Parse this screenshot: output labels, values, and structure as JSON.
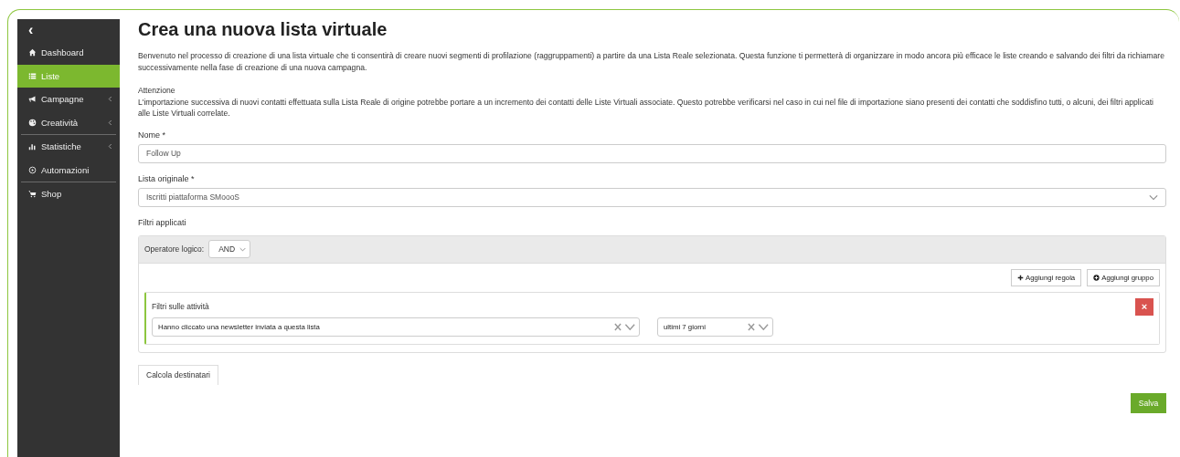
{
  "sidebar": {
    "collapse": "‹",
    "groups": [
      {
        "items": [
          {
            "label": "Dashboard",
            "selected": false,
            "submenu": false
          },
          {
            "label": "Liste",
            "selected": true,
            "submenu": false
          },
          {
            "label": "Campagne",
            "selected": false,
            "submenu": true
          },
          {
            "label": "Creatività",
            "selected": false,
            "submenu": true
          }
        ]
      },
      {
        "items": [
          {
            "label": "Statistiche",
            "selected": false,
            "submenu": true
          },
          {
            "label": "Automazioni",
            "selected": false,
            "submenu": false
          }
        ]
      },
      {
        "items": [
          {
            "label": "Shop",
            "selected": false,
            "submenu": false
          }
        ]
      }
    ]
  },
  "page": {
    "title": "Crea una nuova lista virtuale",
    "intro": "Benvenuto nel processo di creazione di una lista virtuale che ti consentirà di creare nuovi segmenti di profilazione (raggruppamenti) a partire da una Lista Reale selezionata. Questa funzione ti permetterà di organizzare in modo ancora più efficace le liste creando e salvando dei filtri da richiamare successivamente nella fase di creazione di una nuova campagna.",
    "warning_title": "Attenzione",
    "warning": "L'importazione successiva di nuovi contatti effettuata sulla Lista Reale di origine potrebbe portare a un incremento dei contatti delle Liste Virtuali associate. Questo potrebbe verificarsi nel caso in cui nel file di importazione siano presenti dei contatti che soddisfino tutti, o alcuni, dei filtri applicati alle Liste Virtuali correlate."
  },
  "form": {
    "name_label": "Nome *",
    "name_value": "Follow Up",
    "list_label": "Lista originale *",
    "list_value": "Iscritti piattaforma SMoooS",
    "filters_label": "Filtri applicati"
  },
  "builder": {
    "operator_label": "Operatore logico:",
    "operator_value": "AND",
    "add_rule": "Aggiungi regola",
    "add_group": "Aggiungi gruppo",
    "rule": {
      "title": "Filtri sulle attività",
      "activity": "Hanno cliccato una newsletter inviata a questa lista",
      "period": "ultimi 7 giorni",
      "delete": "×"
    }
  },
  "buttons": {
    "calculate": "Calcola destinatari",
    "save": "Salva"
  }
}
